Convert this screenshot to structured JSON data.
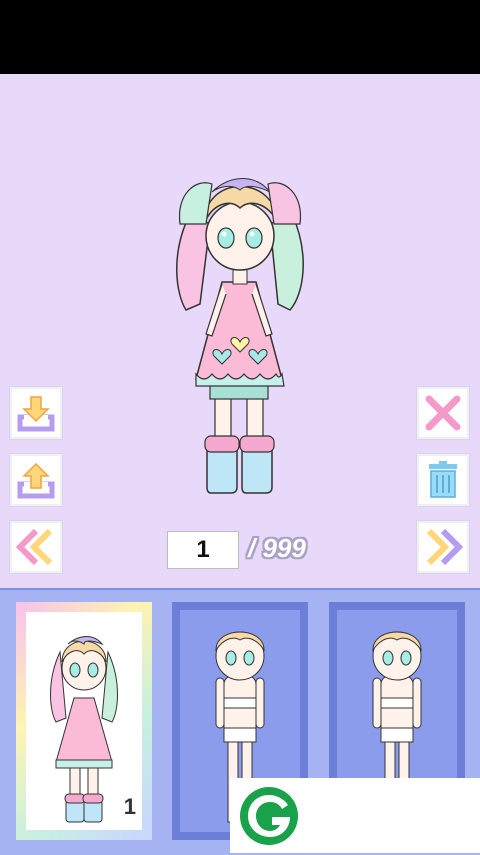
{
  "counter": {
    "current": "1",
    "total": "/ 999"
  },
  "slots": [
    {
      "number": "1",
      "state": "dressed"
    },
    {
      "state": "base"
    },
    {
      "state": "base"
    }
  ],
  "buttons": {
    "save": "download-icon",
    "load": "upload-icon",
    "prev": "double-chevron-left-icon",
    "close": "close-icon",
    "delete": "trash-icon",
    "next": "double-chevron-right-icon"
  },
  "colors": {
    "stage": "#e8d9fb",
    "tray": "#a6b3f3",
    "slot_empty": "#8c9cec",
    "accent_green": "#1aa24b"
  }
}
